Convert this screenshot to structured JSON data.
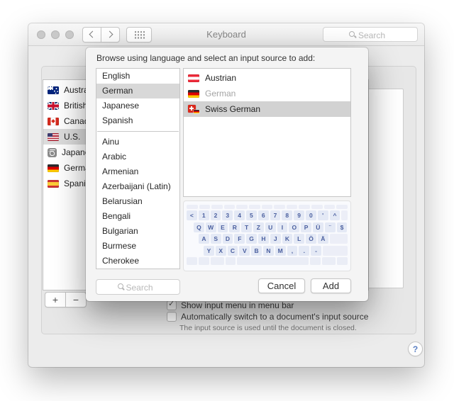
{
  "window": {
    "title": "Keyboard",
    "toolbar": {
      "search_placeholder": "Search"
    }
  },
  "background": {
    "input_sources": [
      {
        "label": "Australian",
        "icon": "australian-flag"
      },
      {
        "label": "British",
        "icon": "british-flag"
      },
      {
        "label": "Canadian",
        "icon": "canadian-flag"
      },
      {
        "label": "U.S.",
        "icon": "us-flag",
        "selected": true
      },
      {
        "label": "Japanese",
        "icon": "japanese-kana"
      },
      {
        "label": "German",
        "icon": "german-flag"
      },
      {
        "label": "Spanish",
        "icon": "spanish-flag"
      }
    ],
    "add_label": "+",
    "remove_label": "−",
    "checkboxes": [
      {
        "label": "Show input menu in menu bar",
        "checked": true
      },
      {
        "label": "Automatically switch to a document's input source",
        "checked": false
      }
    ],
    "note": "The input source is used until the document is closed.",
    "help_label": "?"
  },
  "dialog": {
    "title": "Browse using language and select an input source to add:",
    "languages_primary": [
      {
        "label": "English"
      },
      {
        "label": "German",
        "selected": true
      },
      {
        "label": "Japanese"
      },
      {
        "label": "Spanish"
      }
    ],
    "languages_other": [
      {
        "label": "Ainu"
      },
      {
        "label": "Arabic"
      },
      {
        "label": "Armenian"
      },
      {
        "label": "Azerbaijani (Latin)"
      },
      {
        "label": "Belarusian"
      },
      {
        "label": "Bengali"
      },
      {
        "label": "Bulgarian"
      },
      {
        "label": "Burmese"
      },
      {
        "label": "Cherokee"
      }
    ],
    "sources": [
      {
        "label": "Austrian",
        "icon": "austrian-flag"
      },
      {
        "label": "German",
        "icon": "german-flag",
        "disabled": true
      },
      {
        "label": "Swiss German",
        "icon": "swiss-german-flag",
        "selected": true
      }
    ],
    "keyboard": {
      "blank_top_keys": 13,
      "blank_bottom_keys": 8,
      "rows": [
        [
          "<",
          "1",
          "2",
          "3",
          "4",
          "5",
          "6",
          "7",
          "8",
          "9",
          "0",
          "'",
          "^"
        ],
        [
          "Q",
          "W",
          "E",
          "R",
          "T",
          "Z",
          "U",
          "I",
          "O",
          "P",
          "Ü",
          "¨",
          "$"
        ],
        [
          "A",
          "S",
          "D",
          "F",
          "G",
          "H",
          "J",
          "K",
          "L",
          "Ö",
          "Ä"
        ],
        [
          "Y",
          "X",
          "C",
          "V",
          "B",
          "N",
          "M",
          ",",
          ".",
          "-"
        ]
      ]
    },
    "search_placeholder": "Search",
    "cancel_label": "Cancel",
    "add_label": "Add"
  },
  "colors": {
    "selection_gray": "#d2d2d2",
    "key_letter_blue": "#4a5f9f",
    "key_background": "#e4e9f5",
    "help_question_blue": "#5b7fc4"
  }
}
